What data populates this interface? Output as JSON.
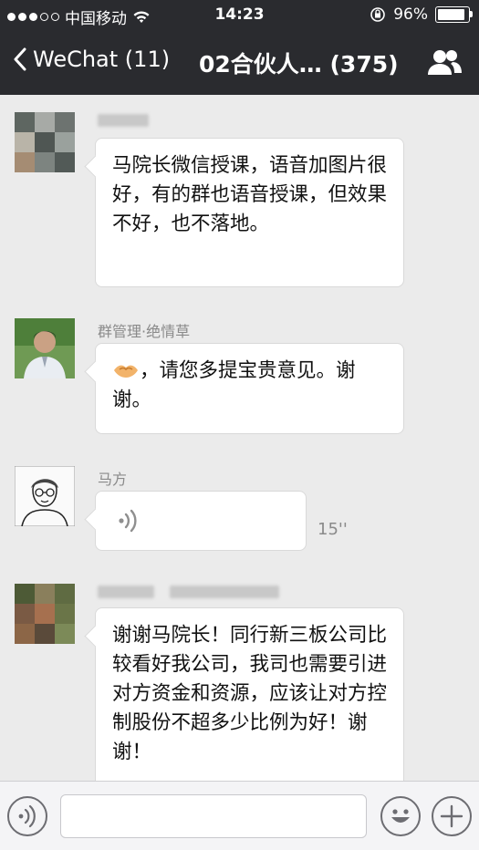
{
  "status_bar": {
    "carrier": "中国移动",
    "time": "14:23",
    "battery_percent": "96%",
    "battery_level": 0.96
  },
  "nav": {
    "back_label": "WeChat (11)",
    "title": "02合伙人… (375)"
  },
  "messages": [
    {
      "sender": "",
      "type": "text",
      "text": "马院长微信授课，语音加图片很好，有的群也语音授课，但效果不好，也不落地。"
    },
    {
      "sender": "群管理·绝情草",
      "type": "text",
      "text": "，请您多提宝贵意见。谢谢。",
      "emoji": "handshake-emoji"
    },
    {
      "sender": "马方",
      "type": "voice",
      "duration": "15''"
    },
    {
      "sender": "",
      "type": "text",
      "text": "谢谢马院长！同行新三板公司比较看好我公司，我司也需要引进对方资金和资源，应该让对方控制股份不超多少比例为好！谢谢！"
    }
  ],
  "input_bar": {
    "left_icon": "voice-icon",
    "middle": "text-input",
    "emoji_icon": "smiley-icon",
    "more_icon": "plus-icon"
  },
  "colors": {
    "nav_bg": "#2a2b2f",
    "chat_bg": "#ebebeb",
    "bubble": "#ffffff"
  }
}
